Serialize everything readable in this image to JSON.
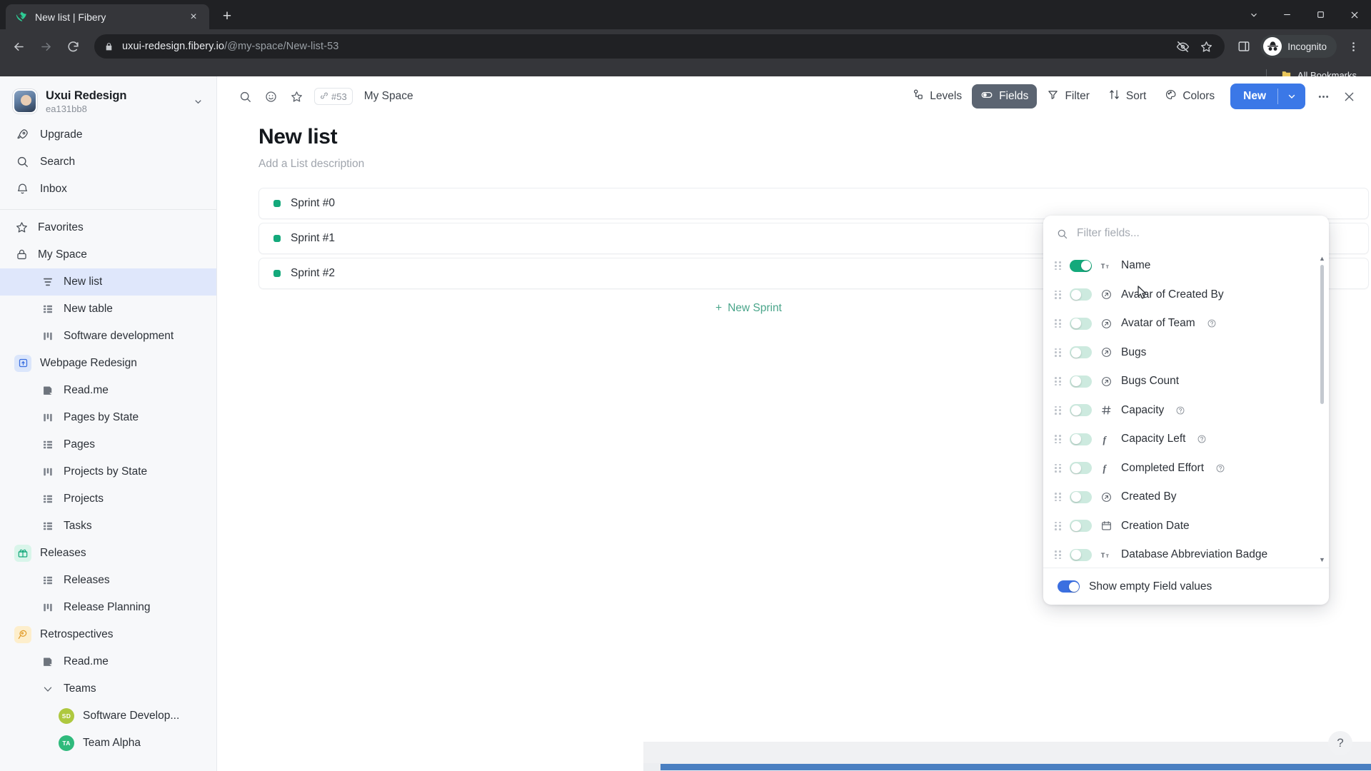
{
  "browser": {
    "tab": {
      "title": "New list | Fibery",
      "favicon": "fibery-leaf-icon",
      "close_label": "×"
    },
    "new_tab_label": "+",
    "window_controls": {
      "minimize": "−",
      "maximize": "▢",
      "close": "✕",
      "tab_search": "⌄"
    },
    "nav": {
      "back": "←",
      "forward": "→",
      "reload": "⟳"
    },
    "omnibox": {
      "lock_icon": "lock-icon",
      "url_domain": "uxui-redesign.fibery.io",
      "url_path": "/@my-space/New-list-53",
      "icons": [
        "eye-slash-icon",
        "star-icon"
      ]
    },
    "side_panel_icon": "side-panel-icon",
    "profile": {
      "label": "Incognito",
      "icon": "incognito-icon"
    },
    "menu_icon": "kebab-menu-icon",
    "bookmarks": {
      "all_bookmarks_label": "All Bookmarks",
      "folder_icon": "folder-icon"
    }
  },
  "sidebar": {
    "workspace": {
      "name": "Uxui Redesign",
      "id": "ea131bb8",
      "chevron": "⌄"
    },
    "nav": [
      {
        "label": "Upgrade",
        "icon": "rocket-icon"
      },
      {
        "label": "Search",
        "icon": "search-icon"
      },
      {
        "label": "Inbox",
        "icon": "bell-icon"
      }
    ],
    "tree": [
      {
        "label": "Favorites",
        "icon": "star-icon",
        "level": 0,
        "active": false
      },
      {
        "label": "My Space",
        "icon": "lock-icon",
        "level": 0,
        "active": false
      },
      {
        "label": "New list",
        "icon": "list-view-icon",
        "level": 1,
        "active": true
      },
      {
        "label": "New table",
        "icon": "table-view-icon",
        "level": 1,
        "active": false
      },
      {
        "label": "Software development",
        "icon": "board-view-icon",
        "level": 1,
        "active": false
      },
      {
        "label": "Webpage Redesign",
        "icon": "space-blue-icon",
        "level": 0,
        "active": false
      },
      {
        "label": "Read.me",
        "icon": "document-icon",
        "level": 1,
        "active": false
      },
      {
        "label": "Pages by State",
        "icon": "board-view-icon",
        "level": 1,
        "active": false
      },
      {
        "label": "Pages",
        "icon": "table-view-icon",
        "level": 1,
        "active": false
      },
      {
        "label": "Projects by State",
        "icon": "board-view-icon",
        "level": 1,
        "active": false
      },
      {
        "label": "Projects",
        "icon": "table-view-icon",
        "level": 1,
        "active": false
      },
      {
        "label": "Tasks",
        "icon": "table-view-icon",
        "level": 1,
        "active": false
      },
      {
        "label": "Releases",
        "icon": "gift-green-icon",
        "level": 0,
        "active": false
      },
      {
        "label": "Releases",
        "icon": "table-view-icon",
        "level": 1,
        "active": false
      },
      {
        "label": "Release Planning",
        "icon": "board-view-icon",
        "level": 1,
        "active": false
      },
      {
        "label": "Retrospectives",
        "icon": "retro-orange-icon",
        "level": 0,
        "active": false
      },
      {
        "label": "Read.me",
        "icon": "document-icon",
        "level": 1,
        "active": false
      },
      {
        "label": "Teams",
        "icon": "chevron-down-icon",
        "level": 1,
        "active": false
      },
      {
        "label": "Software Develop...",
        "icon": "avatar-sd",
        "initials": "SD",
        "color": "#aec83f",
        "level": 2,
        "active": false
      },
      {
        "label": "Team Alpha",
        "icon": "avatar-ta",
        "initials": "TA",
        "color": "#2fba7c",
        "level": 2,
        "active": false
      }
    ]
  },
  "main": {
    "topbar": {
      "search_icon": "search-icon",
      "emoji_icon": "emoji-icon",
      "favorite_icon": "star-icon",
      "id_badge": {
        "link_icon": "link-icon",
        "label": "#53"
      },
      "breadcrumb": "My Space",
      "buttons": [
        {
          "label": "Levels",
          "icon": "levels-icon",
          "active": false
        },
        {
          "label": "Fields",
          "icon": "fields-toggle-icon",
          "active": true
        },
        {
          "label": "Filter",
          "icon": "filter-icon",
          "active": false
        },
        {
          "label": "Sort",
          "icon": "sort-icon",
          "active": false
        },
        {
          "label": "Colors",
          "icon": "palette-icon",
          "active": false
        }
      ],
      "new_button": {
        "label": "New",
        "chevron": "⌄"
      },
      "more_icon": "ellipsis-icon",
      "close_icon": "close-icon"
    },
    "page": {
      "title": "New list",
      "description_placeholder": "Add a List description"
    },
    "rows": [
      {
        "label": "Sprint #0",
        "dot_color": "#14a97b"
      },
      {
        "label": "Sprint #1",
        "dot_color": "#14a97b"
      },
      {
        "label": "Sprint #2",
        "dot_color": "#14a97b"
      }
    ],
    "new_row_button": {
      "plus": "+",
      "label": "New Sprint"
    },
    "help_button": "?"
  },
  "fields_dropdown": {
    "search_placeholder": "Filter fields...",
    "search_value": "",
    "search_icon": "search-icon",
    "items": [
      {
        "name": "Name",
        "type_icon": "text-icon",
        "on": true,
        "help": false
      },
      {
        "name": "Avatar of Created By",
        "type_icon": "relation-icon",
        "on": false,
        "help": false
      },
      {
        "name": "Avatar of Team",
        "type_icon": "relation-icon",
        "on": false,
        "help": true
      },
      {
        "name": "Bugs",
        "type_icon": "relation-icon",
        "on": false,
        "help": false
      },
      {
        "name": "Bugs Count",
        "type_icon": "relation-icon",
        "on": false,
        "help": false
      },
      {
        "name": "Capacity",
        "type_icon": "number-icon",
        "on": false,
        "help": true
      },
      {
        "name": "Capacity Left",
        "type_icon": "formula-icon",
        "on": false,
        "help": true
      },
      {
        "name": "Completed Effort",
        "type_icon": "formula-icon",
        "on": false,
        "help": true
      },
      {
        "name": "Created By",
        "type_icon": "relation-icon",
        "on": false,
        "help": false
      },
      {
        "name": "Creation Date",
        "type_icon": "calendar-icon",
        "on": false,
        "help": false
      },
      {
        "name": "Database Abbreviation Badge",
        "type_icon": "text-icon",
        "on": false,
        "help": false
      }
    ],
    "footer": {
      "label": "Show empty Field values",
      "on": true
    }
  },
  "colors": {
    "accent_blue": "#3b78e7",
    "toggle_green": "#14a97b",
    "toggle_blue": "#3b6fe0",
    "active_btn": "#5b6471",
    "sidebar_active": "#dfe7fb"
  }
}
